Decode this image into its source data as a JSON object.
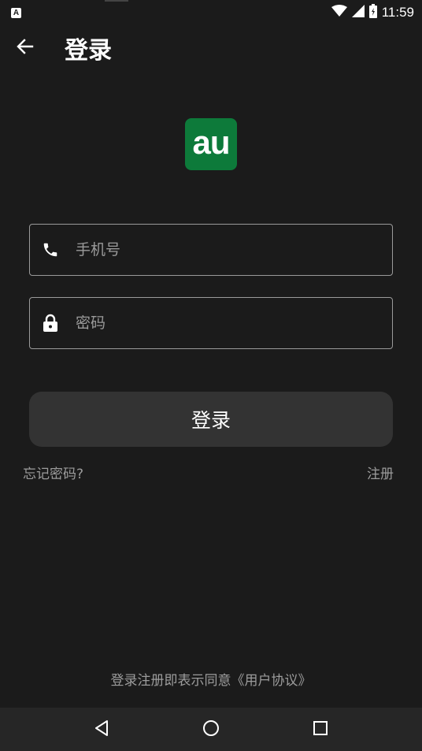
{
  "status_bar": {
    "time": "11:59",
    "app_badge": "A"
  },
  "app_bar": {
    "title": "登录"
  },
  "logo": {
    "text": "au",
    "color": "#0d7a3a"
  },
  "form": {
    "phone_placeholder": "手机号",
    "phone_value": "",
    "password_placeholder": "密码",
    "password_value": "",
    "login_label": "登录"
  },
  "links": {
    "forgot_password": "忘记密码?",
    "register": "注册"
  },
  "agreement": {
    "prefix": "登录注册即表示同意",
    "link_text": "《用户协议》"
  },
  "icons": {
    "back": "arrow-left-icon",
    "phone": "phone-icon",
    "lock": "lock-icon",
    "nav_back": "triangle-back-icon",
    "nav_home": "circle-home-icon",
    "nav_recents": "square-recents-icon"
  }
}
